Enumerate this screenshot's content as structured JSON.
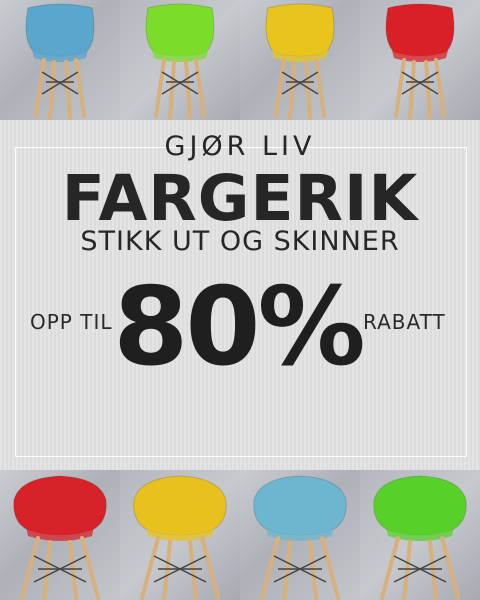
{
  "banner": {
    "eyebrow": "GJØR LIV",
    "headline": "FARGERIK",
    "subheadline": "STIKK UT OG SKINNER",
    "discount_prefix": "OPP TIL",
    "discount_value": "80%",
    "discount_suffix": "RABATT"
  },
  "chairs_top": [
    {
      "name": "blue-side-chair",
      "color": "#5aa6cc"
    },
    {
      "name": "green-side-chair",
      "color": "#7bdd2a"
    },
    {
      "name": "yellow-side-chair",
      "color": "#e8c41c"
    },
    {
      "name": "red-side-chair",
      "color": "#d92026"
    }
  ],
  "chairs_bottom": [
    {
      "name": "red-arm-chair",
      "color": "#d8222a"
    },
    {
      "name": "yellow-arm-chair",
      "color": "#e8c11e"
    },
    {
      "name": "blue-arm-chair",
      "color": "#6cb6cf"
    },
    {
      "name": "green-arm-chair",
      "color": "#58d02a"
    }
  ],
  "colors": {
    "text": "#262626",
    "background": "#e2e2e2",
    "wood_legs": "#d9b07a",
    "metal_base": "#444444"
  }
}
